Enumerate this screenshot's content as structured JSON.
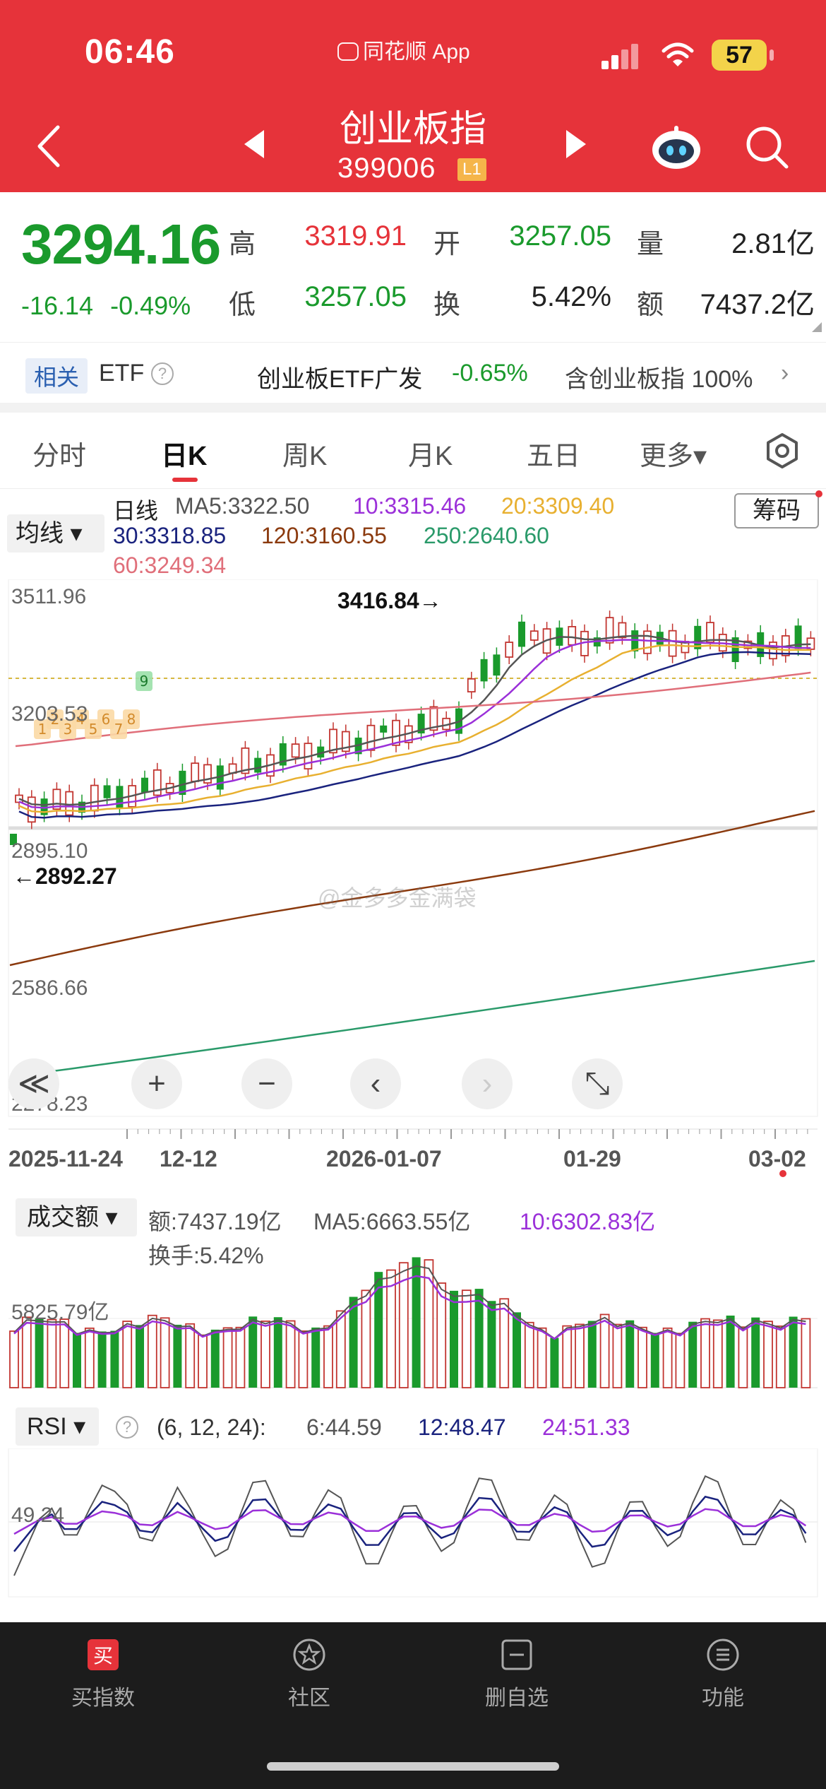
{
  "status": {
    "time": "06:46",
    "app": "同花顺 App",
    "battery": "57"
  },
  "header": {
    "title": "创业板指",
    "code": "399006",
    "level": "L1"
  },
  "quote": {
    "price": "3294.16",
    "change": "-16.14",
    "change_pct": "-0.49%",
    "high_label": "高",
    "high": "3319.91",
    "open_label": "开",
    "open": "3257.05",
    "volume_label": "量",
    "volume": "2.81亿",
    "low_label": "低",
    "low": "3257.05",
    "turnover_label": "换",
    "turnover": "5.42%",
    "amount_label": "额",
    "amount": "7437.2亿"
  },
  "etf": {
    "tag": "相关",
    "label": "ETF",
    "name": "创业板ETF广发",
    "change": "-0.65%",
    "contains": "含创业板指 100%",
    "arrow": "›"
  },
  "tabs": [
    "分时",
    "日K",
    "周K",
    "月K",
    "五日",
    "更多▾"
  ],
  "kchart": {
    "select": "均线 ▾",
    "chip_button": "筹码",
    "legend": {
      "period": "日线",
      "ma5": "MA5:3322.50",
      "ma10": "10:3315.46",
      "ma20": "20:3309.40",
      "ma30": "30:3318.85",
      "ma120": "120:3160.55",
      "ma250": "250:2640.60",
      "ma60": "60:3249.34"
    },
    "y_labels": [
      "3511.96",
      "3203.53",
      "2895.10",
      "2586.66",
      "2278.23"
    ],
    "high_marker": "3416.84→",
    "low_marker": "←2892.27",
    "seq_markers": [
      "1",
      "2",
      "3",
      "4",
      "5",
      "6",
      "7",
      "8",
      "9"
    ],
    "x_labels": [
      "2025-11-24",
      "12-12",
      "2026-01-07",
      "01-29",
      "03-02"
    ],
    "watermark": "@金多多金满袋",
    "controls": [
      "≪",
      "+",
      "−",
      "‹",
      "›",
      "⤡"
    ],
    "colors": {
      "ma5": "#555555",
      "ma10": "#9b30d9",
      "ma20": "#e8b030",
      "ma30": "#1a237e",
      "ma120": "#8b3a0e",
      "ma250": "#2a9a6a",
      "ma60": "#e06f7a",
      "up": "#c23530",
      "down": "#1a9a2c"
    }
  },
  "volume": {
    "select": "成交额 ▾",
    "amount": "额:7437.19亿",
    "ma5": "MA5:6663.55亿",
    "ma10": "10:6302.83亿",
    "turnover": "换手:5.42%",
    "y_label": "5825.79亿"
  },
  "rsi": {
    "select": "RSI ▾",
    "params": "(6, 12, 24):",
    "r6": "6:44.59",
    "r12": "12:48.47",
    "r24": "24:51.33",
    "y_label": "49.24"
  },
  "nav": [
    {
      "label": "买指数",
      "icon": "buy-icon"
    },
    {
      "label": "社区",
      "icon": "community-icon"
    },
    {
      "label": "删自选",
      "icon": "remove-watchlist-icon"
    },
    {
      "label": "功能",
      "icon": "menu-icon"
    }
  ]
}
